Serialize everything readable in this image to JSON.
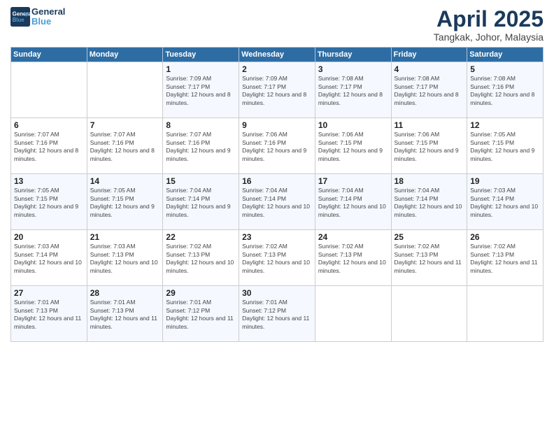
{
  "logo": {
    "line1": "General",
    "line2": "Blue"
  },
  "title": "April 2025",
  "subtitle": "Tangkak, Johor, Malaysia",
  "header_days": [
    "Sunday",
    "Monday",
    "Tuesday",
    "Wednesday",
    "Thursday",
    "Friday",
    "Saturday"
  ],
  "weeks": [
    [
      {
        "day": "",
        "info": ""
      },
      {
        "day": "",
        "info": ""
      },
      {
        "day": "1",
        "info": "Sunrise: 7:09 AM\nSunset: 7:17 PM\nDaylight: 12 hours and 8 minutes."
      },
      {
        "day": "2",
        "info": "Sunrise: 7:09 AM\nSunset: 7:17 PM\nDaylight: 12 hours and 8 minutes."
      },
      {
        "day": "3",
        "info": "Sunrise: 7:08 AM\nSunset: 7:17 PM\nDaylight: 12 hours and 8 minutes."
      },
      {
        "day": "4",
        "info": "Sunrise: 7:08 AM\nSunset: 7:17 PM\nDaylight: 12 hours and 8 minutes."
      },
      {
        "day": "5",
        "info": "Sunrise: 7:08 AM\nSunset: 7:16 PM\nDaylight: 12 hours and 8 minutes."
      }
    ],
    [
      {
        "day": "6",
        "info": "Sunrise: 7:07 AM\nSunset: 7:16 PM\nDaylight: 12 hours and 8 minutes."
      },
      {
        "day": "7",
        "info": "Sunrise: 7:07 AM\nSunset: 7:16 PM\nDaylight: 12 hours and 8 minutes."
      },
      {
        "day": "8",
        "info": "Sunrise: 7:07 AM\nSunset: 7:16 PM\nDaylight: 12 hours and 9 minutes."
      },
      {
        "day": "9",
        "info": "Sunrise: 7:06 AM\nSunset: 7:16 PM\nDaylight: 12 hours and 9 minutes."
      },
      {
        "day": "10",
        "info": "Sunrise: 7:06 AM\nSunset: 7:15 PM\nDaylight: 12 hours and 9 minutes."
      },
      {
        "day": "11",
        "info": "Sunrise: 7:06 AM\nSunset: 7:15 PM\nDaylight: 12 hours and 9 minutes."
      },
      {
        "day": "12",
        "info": "Sunrise: 7:05 AM\nSunset: 7:15 PM\nDaylight: 12 hours and 9 minutes."
      }
    ],
    [
      {
        "day": "13",
        "info": "Sunrise: 7:05 AM\nSunset: 7:15 PM\nDaylight: 12 hours and 9 minutes."
      },
      {
        "day": "14",
        "info": "Sunrise: 7:05 AM\nSunset: 7:15 PM\nDaylight: 12 hours and 9 minutes."
      },
      {
        "day": "15",
        "info": "Sunrise: 7:04 AM\nSunset: 7:14 PM\nDaylight: 12 hours and 9 minutes."
      },
      {
        "day": "16",
        "info": "Sunrise: 7:04 AM\nSunset: 7:14 PM\nDaylight: 12 hours and 10 minutes."
      },
      {
        "day": "17",
        "info": "Sunrise: 7:04 AM\nSunset: 7:14 PM\nDaylight: 12 hours and 10 minutes."
      },
      {
        "day": "18",
        "info": "Sunrise: 7:04 AM\nSunset: 7:14 PM\nDaylight: 12 hours and 10 minutes."
      },
      {
        "day": "19",
        "info": "Sunrise: 7:03 AM\nSunset: 7:14 PM\nDaylight: 12 hours and 10 minutes."
      }
    ],
    [
      {
        "day": "20",
        "info": "Sunrise: 7:03 AM\nSunset: 7:14 PM\nDaylight: 12 hours and 10 minutes."
      },
      {
        "day": "21",
        "info": "Sunrise: 7:03 AM\nSunset: 7:13 PM\nDaylight: 12 hours and 10 minutes."
      },
      {
        "day": "22",
        "info": "Sunrise: 7:02 AM\nSunset: 7:13 PM\nDaylight: 12 hours and 10 minutes."
      },
      {
        "day": "23",
        "info": "Sunrise: 7:02 AM\nSunset: 7:13 PM\nDaylight: 12 hours and 10 minutes."
      },
      {
        "day": "24",
        "info": "Sunrise: 7:02 AM\nSunset: 7:13 PM\nDaylight: 12 hours and 10 minutes."
      },
      {
        "day": "25",
        "info": "Sunrise: 7:02 AM\nSunset: 7:13 PM\nDaylight: 12 hours and 11 minutes."
      },
      {
        "day": "26",
        "info": "Sunrise: 7:02 AM\nSunset: 7:13 PM\nDaylight: 12 hours and 11 minutes."
      }
    ],
    [
      {
        "day": "27",
        "info": "Sunrise: 7:01 AM\nSunset: 7:13 PM\nDaylight: 12 hours and 11 minutes."
      },
      {
        "day": "28",
        "info": "Sunrise: 7:01 AM\nSunset: 7:13 PM\nDaylight: 12 hours and 11 minutes."
      },
      {
        "day": "29",
        "info": "Sunrise: 7:01 AM\nSunset: 7:12 PM\nDaylight: 12 hours and 11 minutes."
      },
      {
        "day": "30",
        "info": "Sunrise: 7:01 AM\nSunset: 7:12 PM\nDaylight: 12 hours and 11 minutes."
      },
      {
        "day": "",
        "info": ""
      },
      {
        "day": "",
        "info": ""
      },
      {
        "day": "",
        "info": ""
      }
    ]
  ]
}
